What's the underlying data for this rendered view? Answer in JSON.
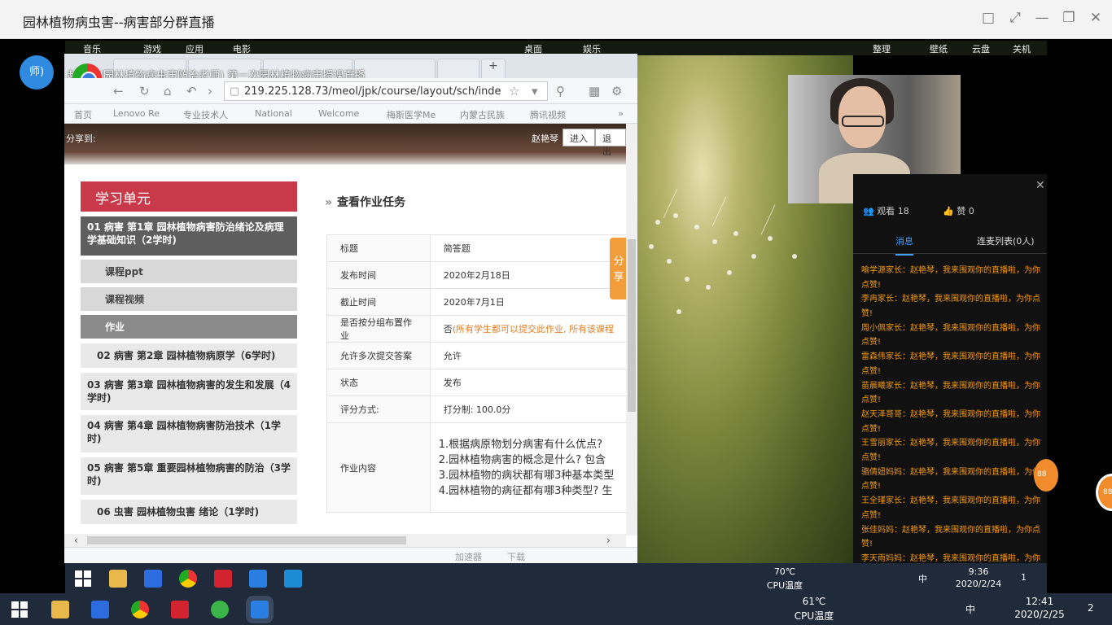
{
  "window": {
    "title": "园林植物病虫害--病害部分群直播",
    "controls": [
      "□",
      "⤢",
      "—",
      "❐",
      "✕"
    ]
  },
  "avatar_text": "师)",
  "desktop_topbar": {
    "left": [
      "音乐",
      "游戏",
      "应用",
      "电影"
    ],
    "middle": [
      "桌面",
      "娱乐"
    ],
    "right": [
      "整理",
      "壁纸",
      "云盘",
      "关机"
    ]
  },
  "browser": {
    "tab_caption": "赵艳琴(园林植物病虫害防治老师) 第一次园林植物病害授课直播",
    "new_tab": "+",
    "url": "219.225.128.73/meol/jpk/course/layout/sch/inde",
    "bookmarks": [
      "首页",
      "Lenovo Re",
      "专业技术人",
      "National",
      "Welcome",
      "梅斯医学Me",
      "内蒙古民族",
      "腾讯视频"
    ],
    "bookmarks_more": "»",
    "header": {
      "share_label": "分享到:",
      "user": "赵艳琴",
      "enter_button": "进入",
      "exit_button": "退出"
    },
    "sidebar": {
      "title": "学习单元",
      "items": [
        {
          "label": "01 病害 第1章 园林植物病害防治绪论及病理学基础知识（2学时)",
          "active": true
        },
        {
          "label": "课程ppt",
          "sub": true
        },
        {
          "label": "课程视频",
          "sub": true
        },
        {
          "label": "作业",
          "sub": true,
          "active": true
        },
        {
          "label": "02 病害 第2章 园林植物病原学（6学时)"
        },
        {
          "label": "03 病害 第3章 园林植物病害的发生和发展（4学时)"
        },
        {
          "label": "04 病害 第4章 园林植物病害防治技术（1学时)"
        },
        {
          "label": "05 病害 第5章 重要园林植物病害的防治（3学时)"
        },
        {
          "label": "06 虫害 园林植物虫害 绪论（1学时)"
        }
      ]
    },
    "main_title": "查看作业任务",
    "task": {
      "rows": [
        {
          "k": "标题",
          "v": "简答题"
        },
        {
          "k": "发布时间",
          "v": "2020年2月18日"
        },
        {
          "k": "截止时间",
          "v": "2020年7月1日"
        },
        {
          "k": "是否按分组布置作业",
          "v": "否",
          "note": "(所有学生都可以提交此作业, 所有该课程"
        },
        {
          "k": "允许多次提交答案",
          "v": "允许"
        },
        {
          "k": "状态",
          "v": "发布"
        },
        {
          "k": "评分方式:",
          "v": "打分制: 100.0分"
        }
      ],
      "content_label": "作业内容",
      "questions": [
        "1.根据病原物划分病害有什么优点?",
        "2.园林植物病害的概念是什么? 包含",
        "3.园林植物的病状都有哪3种基本类型",
        "4.园林植物的病征都有哪3种类型? 生"
      ]
    },
    "share_button": "分享",
    "status": {
      "accelerator": "加速器",
      "download": "下载"
    }
  },
  "chat": {
    "viewers": "观看 18",
    "likes": "赞 0",
    "tab_messages": "消息",
    "tab_mic": "连麦列表(0人)",
    "messages": [
      "喻学源家长：赵艳琴，我来围观你的直播啦，为你点赞!",
      "李冉家长：赵艳琴，我来围观你的直播啦，为你点赞!",
      "周小佩家长：赵艳琴，我来围观你的直播啦，为你点赞!",
      "雷森伟家长：赵艳琴，我来围观你的直播啦，为你点赞!",
      "苗晨曦家长：赵艳琴，我来围观你的直播啦，为你点赞!",
      "赵天泽哥哥：赵艳琴，我来围观你的直播啦，为你点赞!",
      "王雪丽家长：赵艳琴，我来围观你的直播啦，为你点赞!",
      "骆倩妞妈妈：赵艳琴，我来围观你的直播啦，为你点赞!",
      "王全瑾家长：赵艳琴，我来围观你的直播啦，为你点赞!",
      "张佳妈妈：赵艳琴，我来围观你的直播啦，为你点赞!",
      "李天雨妈妈：赵艳琴，我来围观你的直播啦，为你点赞!"
    ]
  },
  "badge": "88",
  "badge2": "88",
  "inner_taskbar": {
    "apps": [
      "file-explorer",
      "wps",
      "chrome",
      "youdao",
      "feishu",
      "video"
    ],
    "temp": "70℃",
    "temp_label": "CPU温度",
    "time": "9:36",
    "date": "2020/2/24",
    "ime": "中",
    "notify": "1"
  },
  "outer_taskbar": {
    "apps": [
      "file-explorer",
      "wps",
      "chrome",
      "youdao",
      "wechat",
      "feishu"
    ],
    "temp": "61℃",
    "temp_label": "CPU温度",
    "time": "12:41",
    "date": "2020/2/25",
    "ime": "中",
    "notify": "2"
  }
}
